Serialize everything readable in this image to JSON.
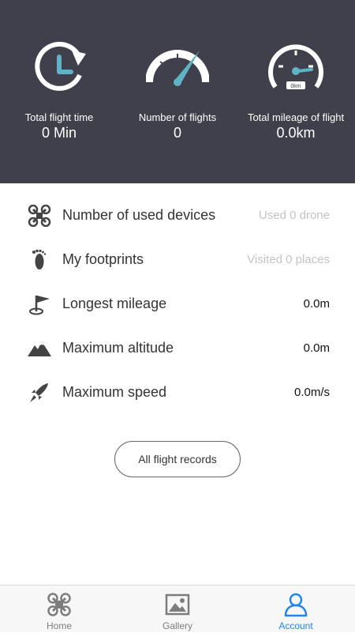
{
  "stats": [
    {
      "label": "Total flight time",
      "value": "0 Min",
      "icon": "clock-history-icon"
    },
    {
      "label": "Number of flights",
      "value": "0",
      "icon": "gauge-icon"
    },
    {
      "label": "Total mileage of flight",
      "value": "0.0km",
      "icon": "odometer-icon",
      "badge": "0km"
    }
  ],
  "list": [
    {
      "label": "Number of used devices",
      "value": "Used 0 drone",
      "icon": "drone-icon"
    },
    {
      "label": "My footprints",
      "value": "Visited 0 places",
      "icon": "footprint-icon"
    },
    {
      "label": "Longest mileage",
      "value": "0.0m",
      "icon": "flag-icon"
    },
    {
      "label": "Maximum altitude",
      "value": "0.0m",
      "icon": "mountain-icon"
    },
    {
      "label": "Maximum speed",
      "value": "0.0m/s",
      "icon": "rocket-icon"
    }
  ],
  "records_button": "All flight records",
  "tabs": [
    {
      "label": "Home",
      "icon": "drone-icon",
      "active": false
    },
    {
      "label": "Gallery",
      "icon": "image-icon",
      "active": false
    },
    {
      "label": "Account",
      "icon": "user-icon",
      "active": true
    }
  ],
  "colors": {
    "header_bg": "#3f404b",
    "accent_teal": "#5fb3c4",
    "active_tab": "#1f86f0"
  }
}
